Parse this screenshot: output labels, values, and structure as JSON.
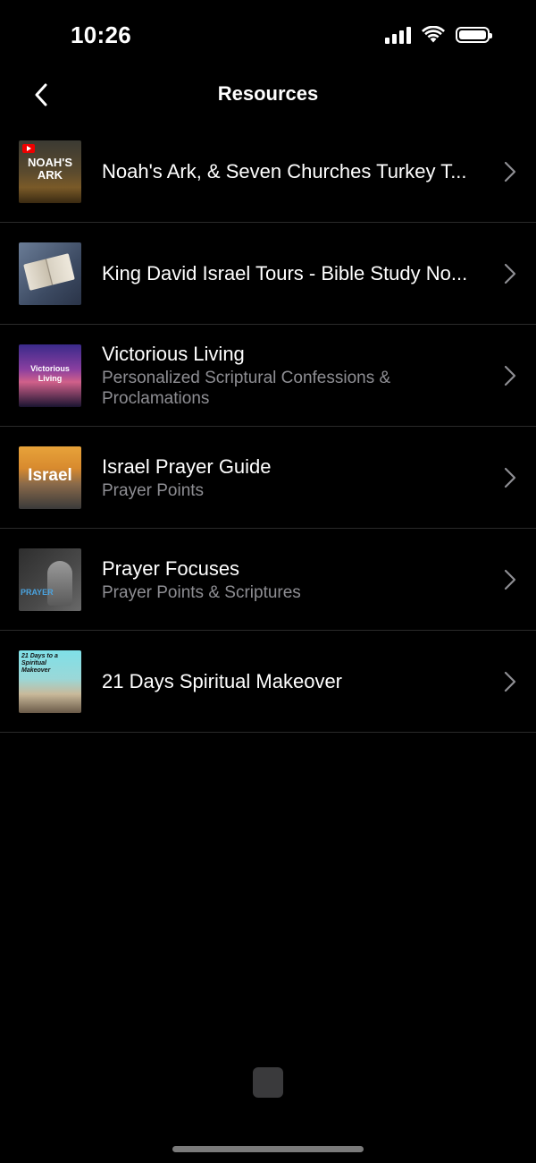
{
  "status_bar": {
    "time": "10:26"
  },
  "nav": {
    "title": "Resources"
  },
  "resources": [
    {
      "title": "Noah's Ark, & Seven Churches Turkey T...",
      "subtitle": "",
      "thumb_text": "NOAH'S ARK",
      "thumb_icon": "play-badge-icon"
    },
    {
      "title": "King David Israel Tours - Bible Study No...",
      "subtitle": "",
      "thumb_text": "",
      "thumb_icon": "open-bible-image"
    },
    {
      "title": "Victorious Living",
      "subtitle": "Personalized Scriptural Confessions & Proclamations",
      "thumb_text": "Victorious Living",
      "thumb_icon": "sunset-image"
    },
    {
      "title": "Israel Prayer Guide",
      "subtitle": "Prayer Points",
      "thumb_text": "Israel",
      "thumb_icon": "city-image"
    },
    {
      "title": "Prayer Focuses",
      "subtitle": "Prayer Points & Scriptures",
      "thumb_text": "PRAYER",
      "thumb_icon": "portrait-image"
    },
    {
      "title": "21 Days Spiritual Makeover",
      "subtitle": "",
      "thumb_text": "21 Days to a Spiritual Makeover",
      "thumb_icon": "book-cover-image"
    }
  ],
  "colors": {
    "background": "#000000",
    "separator": "#2a2a2a",
    "subtitle": "#8e8e93",
    "chevron": "#8e8e93"
  }
}
